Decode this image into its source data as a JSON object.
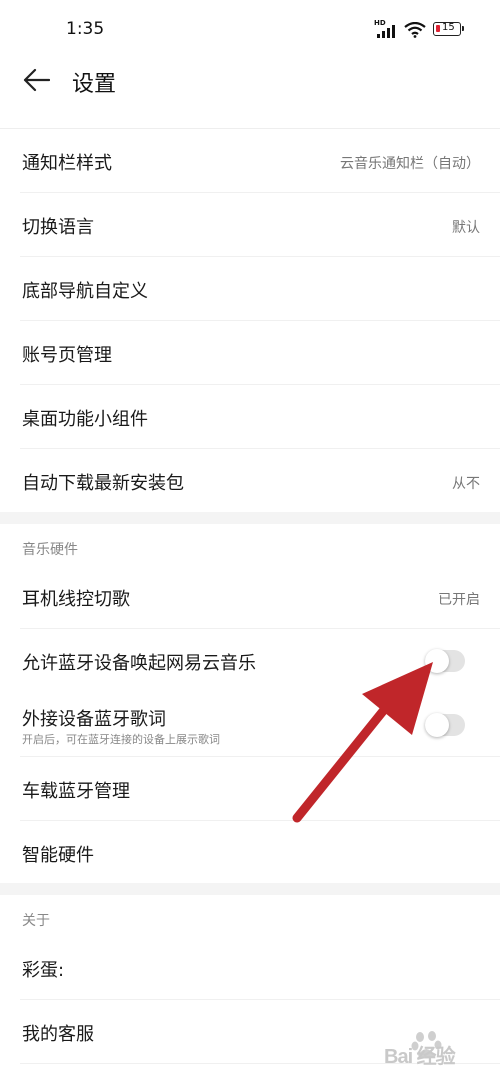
{
  "status_bar": {
    "time": "1:35",
    "battery": "15",
    "network": "HD"
  },
  "header": {
    "title": "设置"
  },
  "general_items": [
    {
      "label": "通知栏样式",
      "value": "云音乐通知栏（自动）"
    },
    {
      "label": "切换语言",
      "value": "默认"
    },
    {
      "label": "底部导航自定义"
    },
    {
      "label": "账号页管理"
    },
    {
      "label": "桌面功能小组件"
    },
    {
      "label": "自动下载最新安装包",
      "value": "从不"
    }
  ],
  "music_hardware": {
    "title": "音乐硬件",
    "items": [
      {
        "label": "耳机线控切歌",
        "value": "已开启"
      },
      {
        "label": "允许蓝牙设备唤起网易云音乐",
        "toggle": "off"
      },
      {
        "label": "外接设备蓝牙歌词",
        "subtitle": "开启后，可在蓝牙连接的设备上展示歌词",
        "toggle": "off"
      },
      {
        "label": "车载蓝牙管理"
      },
      {
        "label": "智能硬件"
      }
    ]
  },
  "about": {
    "title": "关于",
    "items": [
      {
        "label": "彩蛋:"
      },
      {
        "label": "我的客服"
      }
    ]
  },
  "watermark": {
    "text": "Bai 经验"
  },
  "colors": {
    "annotation_arrow": "#c0262a",
    "toggle_off": "#e3e3e3"
  }
}
